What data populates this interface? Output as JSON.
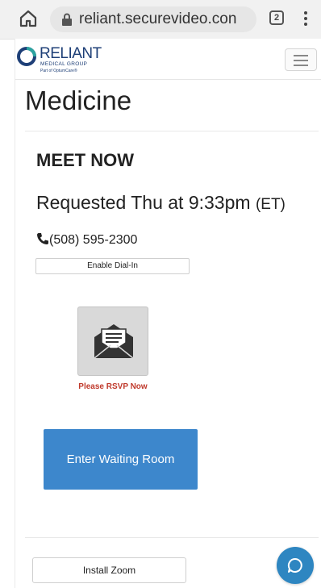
{
  "browser": {
    "url": "reliant.securevideo.con",
    "tab_count": "2"
  },
  "header": {
    "logo_name": "RELIANT",
    "logo_sub": "MEDICAL GROUP",
    "logo_tag": "Part of OptumCare®"
  },
  "page": {
    "title": "Medicine",
    "meeting_label": "MEET NOW",
    "requested": "Requested Thu at 9:33pm",
    "timezone": "(ET)",
    "phone": "(508) 595-2300",
    "dialin_label": "Enable Dial-In",
    "rsvp_label": "Please RSVP Now",
    "waiting_room_label": "Enter Waiting Room",
    "zoom_label": "Install Zoom"
  },
  "colors": {
    "brand_navy": "#1e3f77",
    "primary_button": "#3d87cc",
    "rsvp_red": "#c0392b",
    "chat_button": "#2e86c1"
  },
  "icons": [
    "home-icon",
    "lock-icon",
    "tabs-icon",
    "kebab-menu-icon",
    "hamburger-menu-icon",
    "phone-icon",
    "envelope-icon",
    "chat-icon"
  ]
}
